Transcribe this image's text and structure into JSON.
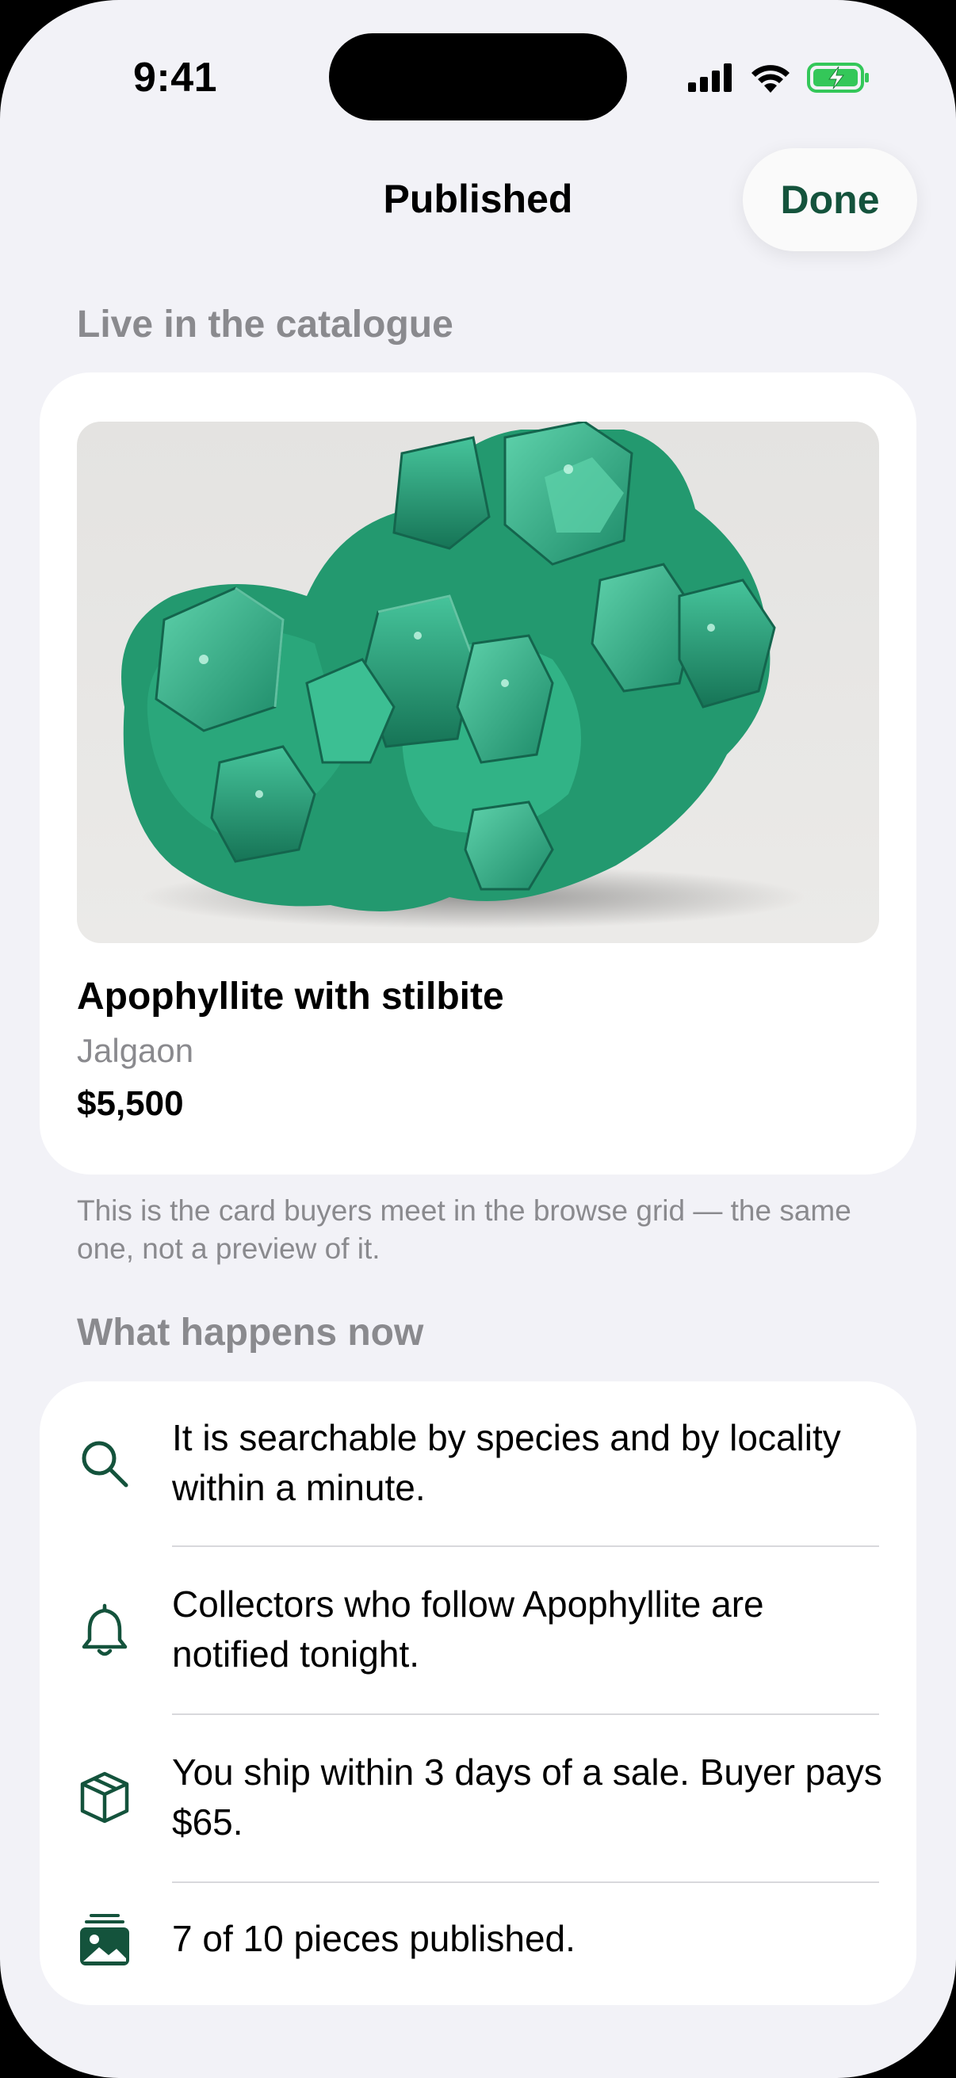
{
  "status_bar": {
    "time": "9:41"
  },
  "nav": {
    "title": "Published",
    "done_label": "Done"
  },
  "catalogue_section": {
    "header": "Live in the catalogue"
  },
  "listing": {
    "title": "Apophyllite with stilbite",
    "locality": "Jalgaon",
    "price": "$5,500"
  },
  "footnote": "This is the card buyers meet in the browse grid — the same one, not a preview of it.",
  "next_section": {
    "header": "What happens now",
    "items": [
      {
        "icon": "search-icon",
        "text": "It is searchable by species and by locality within a minute."
      },
      {
        "icon": "bell-icon",
        "text": "Collectors who follow Apophyllite are notified tonight."
      },
      {
        "icon": "package-icon",
        "text": "You ship within 3 days of a sale. Buyer pays $65."
      },
      {
        "icon": "photo-stack-icon",
        "text": "7 of 10 pieces published."
      }
    ]
  },
  "colors": {
    "accent": "#14533c",
    "background": "#f2f2f7",
    "mineral": "#2fa883"
  }
}
